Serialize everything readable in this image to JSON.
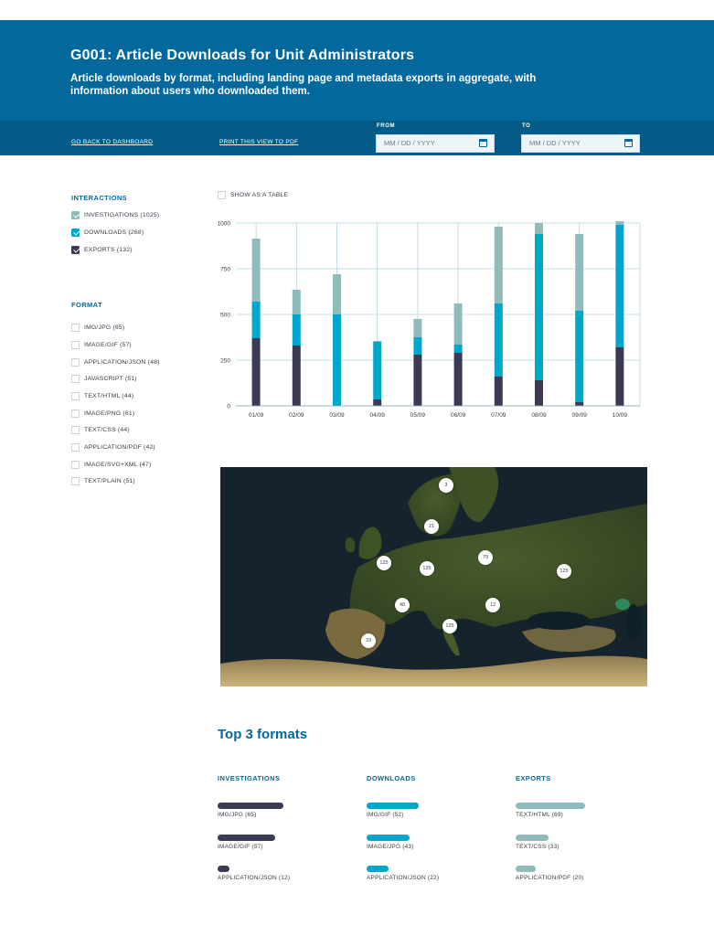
{
  "header": {
    "title": "G001: Article Downloads for Unit Administrators",
    "subtitle": "Article downloads by format, including landing page and metadata exports in aggregate, with information about users who downloaded them."
  },
  "toolbar": {
    "back_link": "GO BACK TO DASHBOARD",
    "print_link": "PRINT THIS VIEW TO PDF",
    "from_label": "FROM",
    "to_label": "TO",
    "from_placeholder": "MM / DD / YYYY",
    "to_placeholder": "MM / DD / YYYY"
  },
  "interactions": {
    "title": "INTERACTIONS",
    "items": [
      {
        "label": "INVESTIGATIONS (1025)",
        "checked": true,
        "color": "#8fbcbb"
      },
      {
        "label": "DOWNLOADS (268)",
        "checked": true,
        "color": "#00a7cc"
      },
      {
        "label": "EXPORTS (132)",
        "checked": true,
        "color": "#3b3a54"
      }
    ]
  },
  "format": {
    "title": "FORMAT",
    "items": [
      "IMG/JPG (65)",
      "IMAGE/GIF (57)",
      "APPLICATION/JSON (48)",
      "JAVASCRIPT (51)",
      "TEXT/HTML (44)",
      "IMAGE/PNG (61)",
      "TEXT/CSS (44)",
      "APPLICATION/PDF (42)",
      "IMAGE/SVG+XML (47)",
      "TEXT/PLAIN (51)"
    ]
  },
  "show_table_label": "SHOW AS A TABLE",
  "chart_data": {
    "type": "bar",
    "stacked": true,
    "categories": [
      "01/09",
      "02/09",
      "03/09",
      "04/09",
      "05/09",
      "06/09",
      "07/09",
      "08/09",
      "09/09",
      "10/09"
    ],
    "series": [
      {
        "name": "EXPORTS",
        "color": "#3b3a54",
        "values": [
          370,
          330,
          0,
          35,
          280,
          290,
          160,
          140,
          20,
          320
        ]
      },
      {
        "name": "DOWNLOADS",
        "color": "#00a7cc",
        "values": [
          200,
          170,
          500,
          315,
          95,
          45,
          400,
          800,
          500,
          670
        ]
      },
      {
        "name": "INVESTIGATIONS",
        "color": "#8fbcbb",
        "values": [
          345,
          135,
          220,
          5,
          100,
          225,
          420,
          60,
          420,
          20
        ]
      }
    ],
    "yticks": [
      0,
      250,
      500,
      750,
      1000
    ],
    "ylim": [
      0,
      1000
    ],
    "grid": true
  },
  "map": {
    "pins": [
      "3",
      "21",
      "125",
      "79",
      "125",
      "125",
      "48",
      "12",
      "125",
      "33"
    ]
  },
  "top3": {
    "title": "Top 3 formats",
    "columns": [
      {
        "title": "INVESTIGATIONS",
        "color": "#3b3a54",
        "items": [
          {
            "label": "IMG/JPG (65)",
            "value": 65
          },
          {
            "label": "IMAGE/GIF (57)",
            "value": 57
          },
          {
            "label": "APPLICATION/JSON (12)",
            "value": 12
          }
        ]
      },
      {
        "title": "DOWNLOADS",
        "color": "#00a7cc",
        "items": [
          {
            "label": "IMG/GIF (52)",
            "value": 52
          },
          {
            "label": "IMAGE/JPG (43)",
            "value": 43
          },
          {
            "label": "APPLICATION/JSON (22)",
            "value": 22
          }
        ]
      },
      {
        "title": "EXPORTS",
        "color": "#8fbcbb",
        "items": [
          {
            "label": "TEXT/HTML (69)",
            "value": 69
          },
          {
            "label": "TEXT/CSS (33)",
            "value": 33
          },
          {
            "label": "APPLICATION/PDF (20)",
            "value": 20
          }
        ]
      }
    ]
  }
}
